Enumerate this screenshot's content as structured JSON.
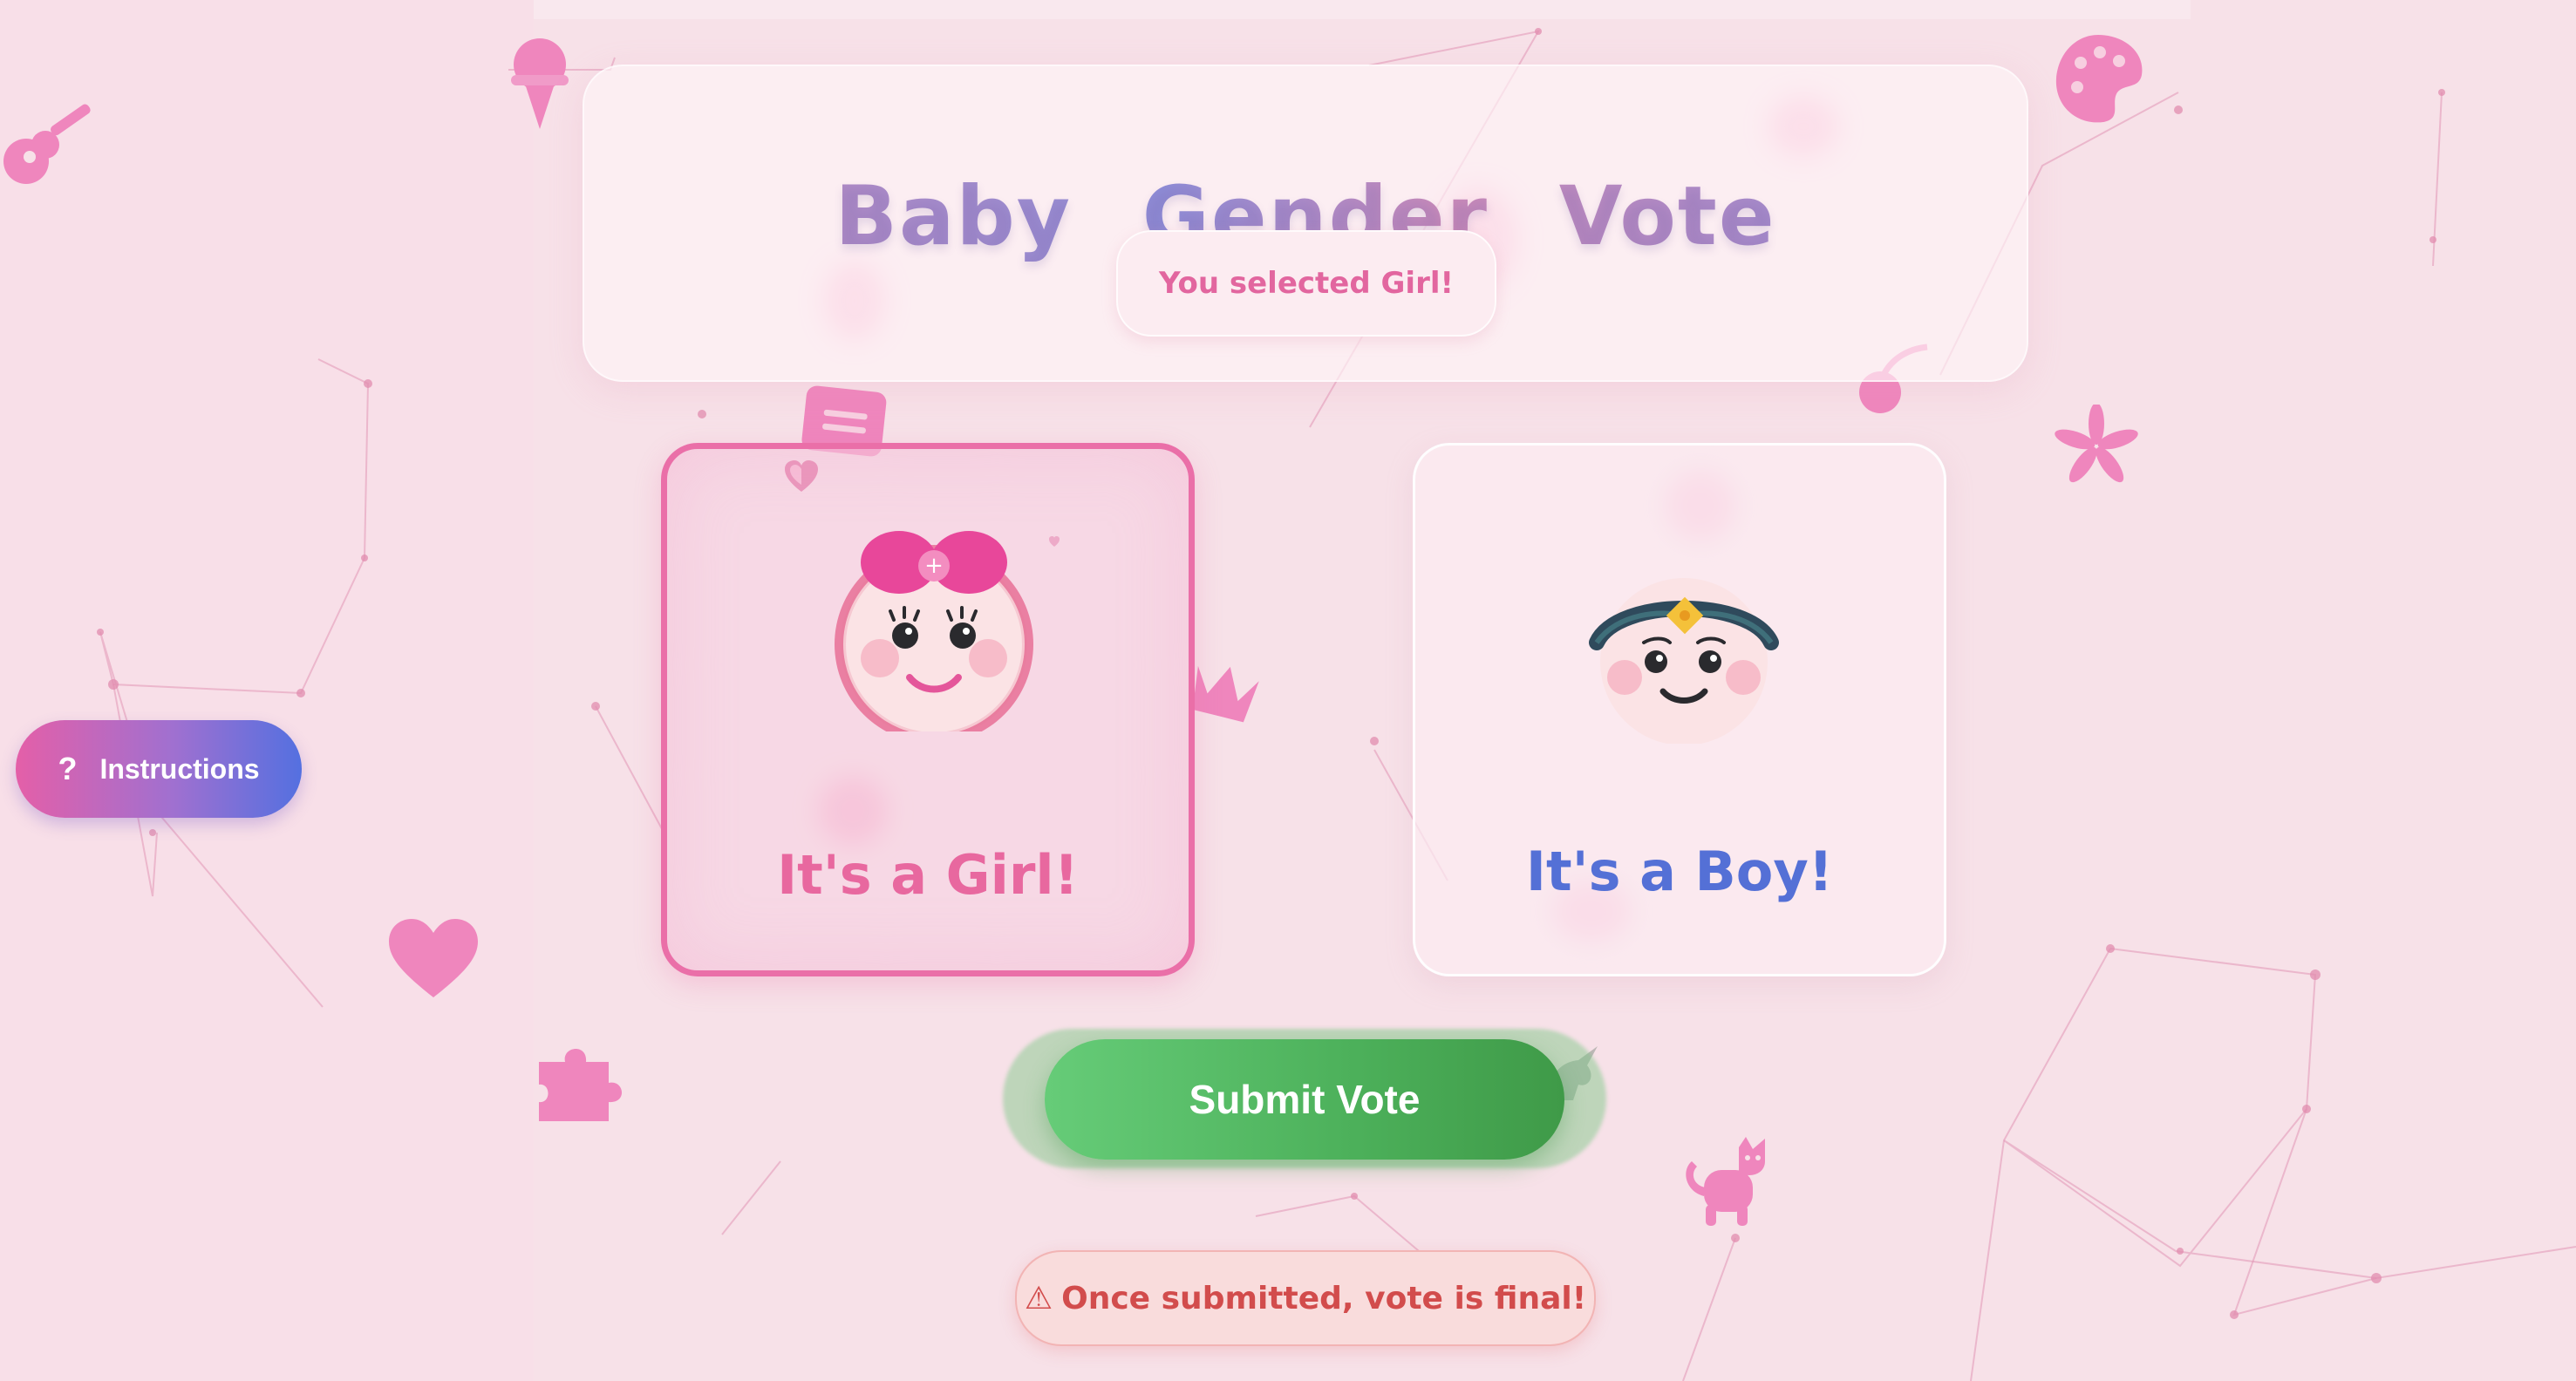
{
  "header": {
    "title": "Baby Gender Vote",
    "selection_status": "You selected Girl!"
  },
  "options": {
    "girl": {
      "label": "It's a Girl!",
      "selected": true
    },
    "boy": {
      "label": "It's a Boy!",
      "selected": false
    }
  },
  "actions": {
    "submit_label": "Submit Vote",
    "instructions_label": "Instructions",
    "instructions_icon": "?"
  },
  "warning": {
    "icon": "⚠",
    "text": "Once submitted, vote is final!"
  },
  "colors": {
    "accent_pink": "#ea6fa8",
    "accent_blue": "#5470d6",
    "submit_green": "#4cb05a",
    "warning_red": "#d24c4c",
    "background": "#f7e1e8"
  },
  "decorative_icons": [
    "guitar-icon",
    "ice-cream-icon",
    "palette-icon",
    "note-icon",
    "crown-icon",
    "heart-icon",
    "puzzle-icon",
    "cat-icon",
    "flower-icon",
    "cherry-icon",
    "gem-heart-icon",
    "unicorn-icon"
  ]
}
